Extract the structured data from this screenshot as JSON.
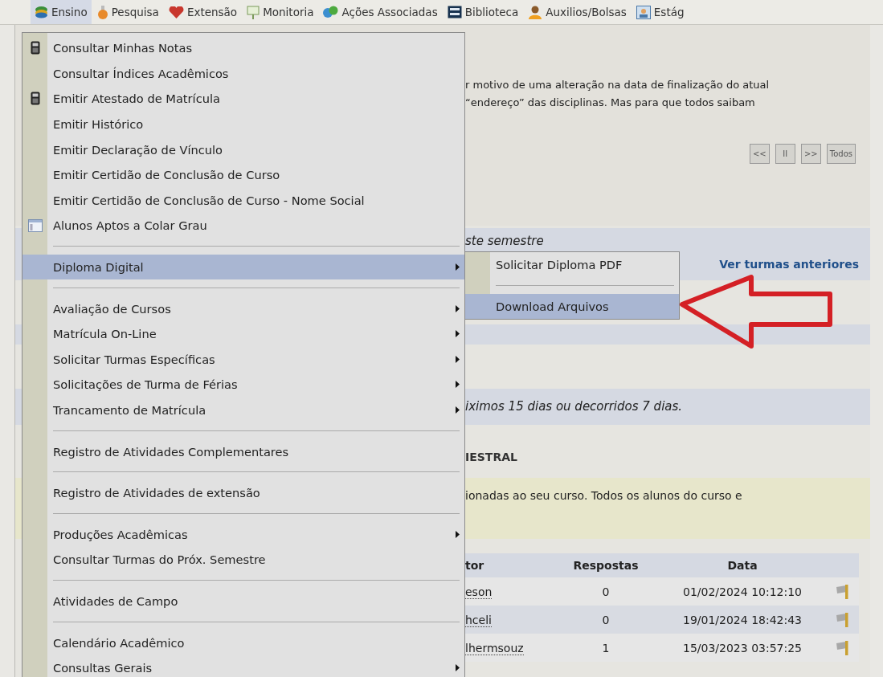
{
  "menubar": [
    {
      "label": "Ensino",
      "selected": true
    },
    {
      "label": "Pesquisa",
      "selected": false
    },
    {
      "label": "Extensão",
      "selected": false
    },
    {
      "label": "Monitoria",
      "selected": false
    },
    {
      "label": "Ações Associadas",
      "selected": false
    },
    {
      "label": "Biblioteca",
      "selected": false
    },
    {
      "label": "Auxilios/Bolsas",
      "selected": false
    },
    {
      "label": "Estág",
      "selected": false
    }
  ],
  "dropdown": {
    "items": [
      {
        "kind": "item",
        "label": "Consultar Minhas Notas",
        "submenu": false,
        "selected": false
      },
      {
        "kind": "item",
        "label": "Consultar Índices Acadêmicos",
        "submenu": false,
        "selected": false
      },
      {
        "kind": "item",
        "label": "Emitir Atestado de Matrícula",
        "submenu": false,
        "selected": false
      },
      {
        "kind": "item",
        "label": "Emitir Histórico",
        "submenu": false,
        "selected": false
      },
      {
        "kind": "item",
        "label": "Emitir Declaração de Vínculo",
        "submenu": false,
        "selected": false
      },
      {
        "kind": "item",
        "label": "Emitir Certidão de Conclusão de Curso",
        "submenu": false,
        "selected": false
      },
      {
        "kind": "item",
        "label": "Emitir Certidão de Conclusão de Curso - Nome Social",
        "submenu": false,
        "selected": false
      },
      {
        "kind": "item",
        "label": "Alunos Aptos a Colar Grau",
        "submenu": false,
        "selected": false
      },
      {
        "kind": "separator"
      },
      {
        "kind": "item",
        "label": "Diploma Digital",
        "submenu": true,
        "selected": true
      },
      {
        "kind": "separator"
      },
      {
        "kind": "item",
        "label": "Avaliação de Cursos",
        "submenu": true,
        "selected": false
      },
      {
        "kind": "item",
        "label": "Matrícula On-Line",
        "submenu": true,
        "selected": false
      },
      {
        "kind": "item",
        "label": "Solicitar Turmas Específicas",
        "submenu": true,
        "selected": false
      },
      {
        "kind": "item",
        "label": "Solicitações de Turma de Férias",
        "submenu": true,
        "selected": false
      },
      {
        "kind": "item",
        "label": "Trancamento de Matrícula",
        "submenu": true,
        "selected": false
      },
      {
        "kind": "separator"
      },
      {
        "kind": "item",
        "label": "Registro de Atividades Complementares",
        "submenu": false,
        "selected": false
      },
      {
        "kind": "separator"
      },
      {
        "kind": "item",
        "label": "Registro de Atividades de extensão",
        "submenu": false,
        "selected": false
      },
      {
        "kind": "separator"
      },
      {
        "kind": "item",
        "label": "Produções Acadêmicas",
        "submenu": true,
        "selected": false
      },
      {
        "kind": "item",
        "label": "Consultar Turmas do Próx. Semestre",
        "submenu": false,
        "selected": false
      },
      {
        "kind": "separator"
      },
      {
        "kind": "item",
        "label": "Atividades de Campo",
        "submenu": false,
        "selected": false
      },
      {
        "kind": "separator"
      },
      {
        "kind": "item",
        "label": "Calendário Acadêmico",
        "submenu": false,
        "selected": false
      },
      {
        "kind": "item",
        "label": "Consultas Gerais",
        "submenu": true,
        "selected": false
      }
    ]
  },
  "submenu": {
    "items": [
      {
        "kind": "item",
        "label": "Solicitar Diploma PDF",
        "selected": false
      },
      {
        "kind": "separator"
      },
      {
        "kind": "item",
        "label": "Download Arquivos",
        "selected": true
      }
    ]
  },
  "notice": {
    "lines": [
      "r motivo de uma alteração na data de finalização do atual",
      "“endereço” das disciplinas. Mas para que todos saibam"
    ],
    "controls": [
      "<<",
      "II",
      ">>",
      "Todos"
    ]
  },
  "classes": {
    "heading": "ste semestre",
    "link": "Ver turmas anteriores"
  },
  "reminder": "iximos 15 dias ou decorridos 7 dias.",
  "forum": {
    "title": "IESTRAL",
    "info": "ionadas ao seu curso. Todos os alunos do curso e",
    "columns": [
      "tor",
      "Respostas",
      "Data"
    ],
    "rows": [
      [
        "eson",
        "0",
        "01/02/2024 10:12:10"
      ],
      [
        "hceli",
        "0",
        "19/01/2024 18:42:43"
      ],
      [
        "lhermsouz",
        "1",
        "15/03/2023 03:57:25"
      ]
    ]
  }
}
